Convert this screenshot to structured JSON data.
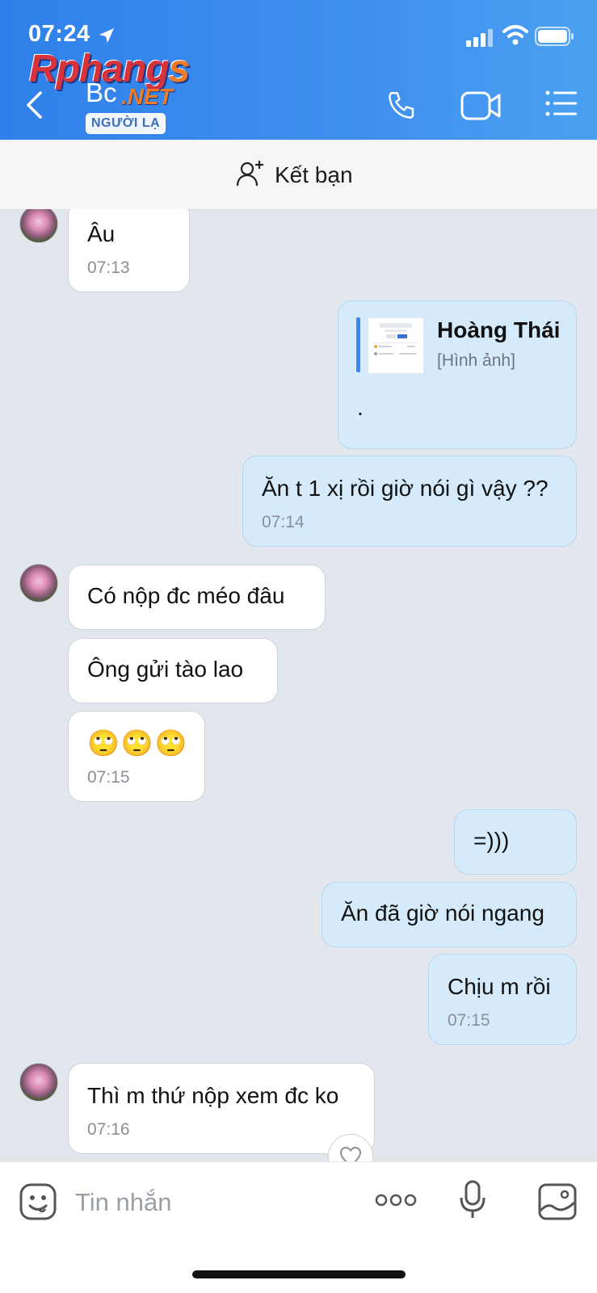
{
  "status_bar": {
    "time": "07:24"
  },
  "watermark": {
    "brand": "Rphang",
    "brand_s": "s",
    "net": ".NET"
  },
  "header": {
    "contact_name": "Bc",
    "badge": "NGƯỜI LẠ"
  },
  "add_friend": {
    "label": "Kết bạn"
  },
  "messages": [
    {
      "dir": "in",
      "text": "Âu",
      "time": "07:13"
    },
    {
      "dir": "out",
      "type": "quote",
      "quote_name": "Hoàng Thái",
      "quote_sub": "[Hình ảnh]",
      "text": "."
    },
    {
      "dir": "out",
      "text": "Ăn t 1 xị rồi giờ nói gì vậy ??",
      "time": "07:14"
    },
    {
      "dir": "in",
      "text": "Có nộp đc méo đâu"
    },
    {
      "dir": "in",
      "text": "Ông gửi tào lao"
    },
    {
      "dir": "in",
      "text": "🙄🙄🙄",
      "time": "07:15"
    },
    {
      "dir": "out",
      "text": "=)))"
    },
    {
      "dir": "out",
      "text": "Ăn đã giờ nói ngang"
    },
    {
      "dir": "out",
      "text": "Chịu m rồi",
      "time": "07:15"
    },
    {
      "dir": "in",
      "text": "Thì m thứ nộp xem đc ko",
      "time": "07:16"
    }
  ],
  "input": {
    "placeholder": "Tin nhắn"
  },
  "colors": {
    "header": "#3a8bed",
    "outgoing_bubble": "#d5ebfc",
    "incoming_bubble": "#ffffff",
    "background": "#e2e6ed"
  },
  "icons": [
    "location-arrow-icon",
    "signal-icon",
    "wifi-icon",
    "battery-icon",
    "back-icon",
    "phone-icon",
    "video-camera-icon",
    "menu-list-icon",
    "add-friend-icon",
    "heart-icon",
    "sticker-icon",
    "more-icon",
    "microphone-icon",
    "image-icon"
  ]
}
